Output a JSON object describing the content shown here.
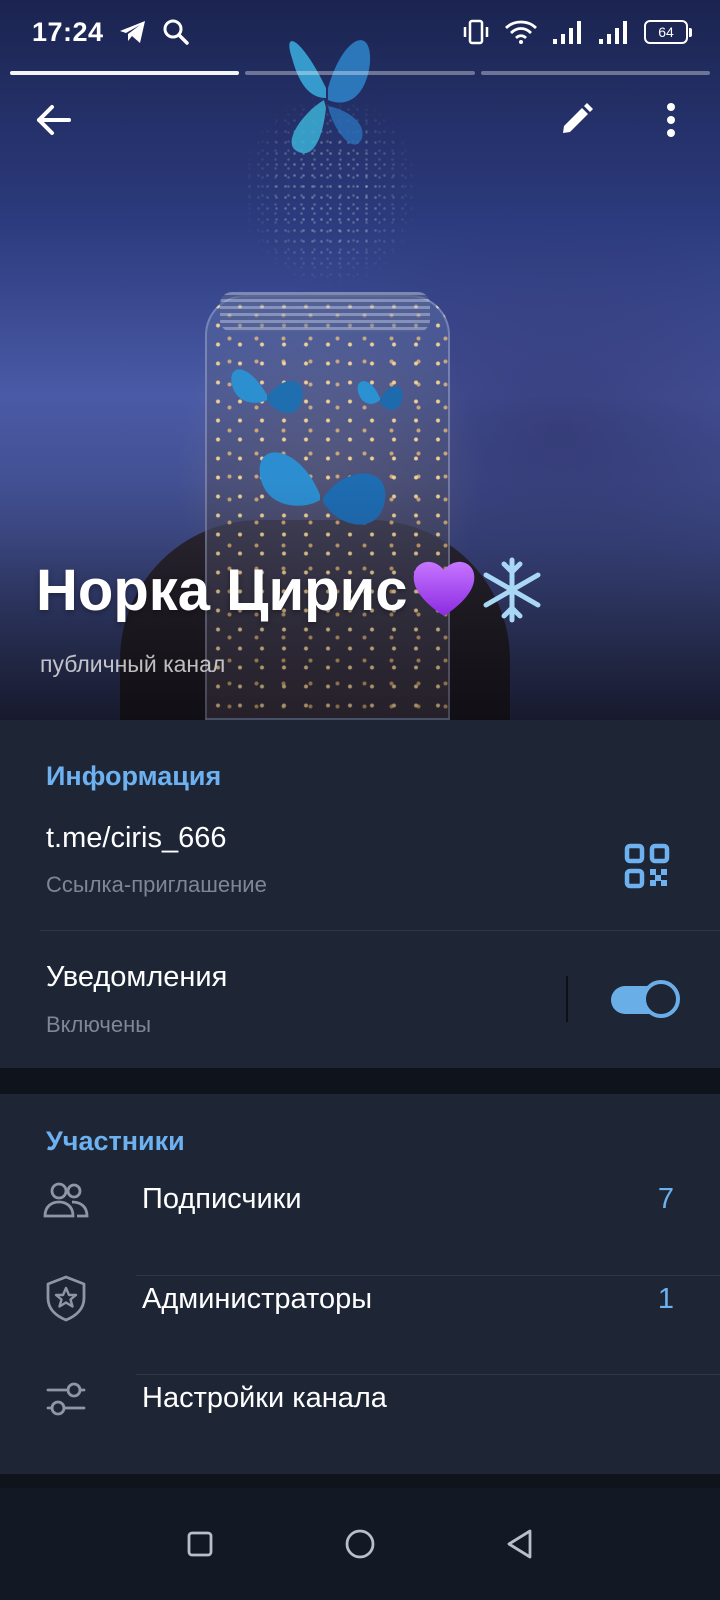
{
  "status_bar": {
    "time": "17:24",
    "battery": "64",
    "icons": [
      "telegram-icon",
      "search-icon",
      "vibrate-icon",
      "wifi-icon",
      "signal-icon",
      "signal-icon",
      "battery-icon"
    ]
  },
  "story": {
    "segments": 3,
    "active_index": 0
  },
  "toolbar": {
    "back_icon": "arrow-left-icon",
    "edit_icon": "pencil-icon",
    "menu_icon": "more-vertical-icon"
  },
  "channel": {
    "name": "Норка Цирис",
    "name_emojis": [
      "purple-heart",
      "snowflake"
    ],
    "type": "публичный канал"
  },
  "info": {
    "title": "Информация",
    "link": "t.me/ciris_666",
    "link_caption": "Ссылка-приглашение",
    "qr_icon": "qr-code-icon",
    "notifications_label": "Уведомления",
    "notifications_state": "Включены",
    "notifications_enabled": true
  },
  "members": {
    "title": "Участники",
    "items": [
      {
        "icon": "users-icon",
        "label": "Подписчики",
        "count": "7"
      },
      {
        "icon": "shield-star-icon",
        "label": "Администраторы",
        "count": "1"
      },
      {
        "icon": "settings-sliders-icon",
        "label": "Настройки канала",
        "count": ""
      }
    ]
  },
  "nav": {
    "icons": [
      "square-icon",
      "circle-icon",
      "triangle-back-icon"
    ]
  },
  "colors": {
    "accent": "#6db1f0",
    "card_bg": "#1e2636",
    "page_bg": "#0f141c",
    "muted_text": "#7d8796"
  }
}
